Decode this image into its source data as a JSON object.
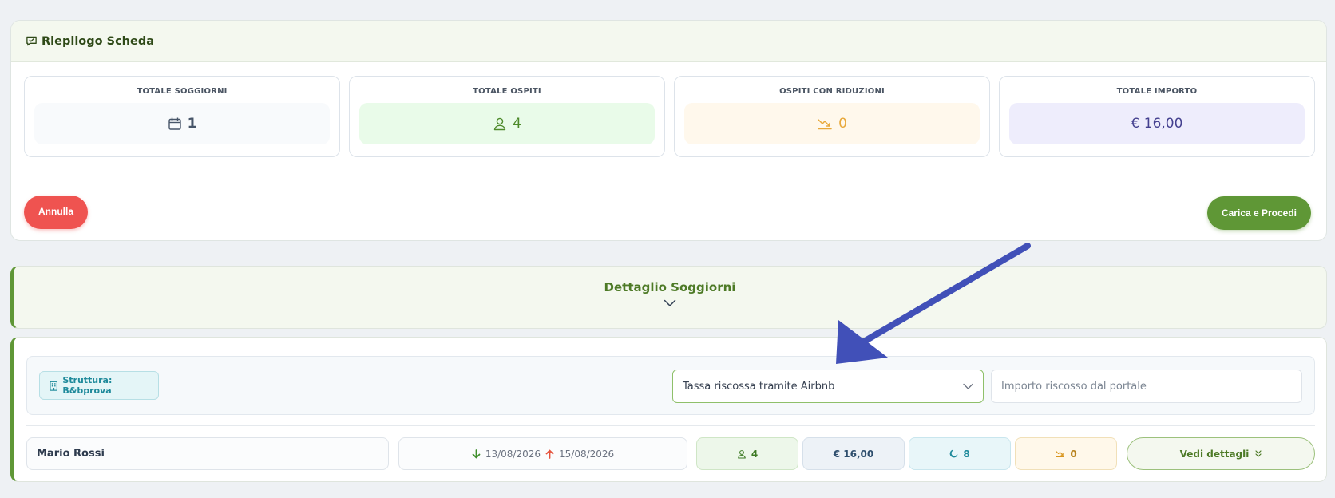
{
  "summary": {
    "title": "Riepilogo Scheda",
    "stats": [
      {
        "label": "TOTALE SOGGIORNI",
        "value": "1",
        "icon": "calendar-icon",
        "color": "#475569"
      },
      {
        "label": "TOTALE OSPITI",
        "value": "4",
        "icon": "user-icon",
        "color": "#4d8a2a"
      },
      {
        "label": "OSPITI CON RIDUZIONI",
        "value": "0",
        "icon": "trend-down-icon",
        "color": "#e8a83a"
      },
      {
        "label": "TOTALE IMPORTO",
        "value": "€ 16,00",
        "icon": "",
        "color": "#44408f"
      }
    ],
    "cancel_label": "Annulla",
    "submit_label": "Carica e Procedi"
  },
  "dettaglio": {
    "title": "Dettaglio Soggiorni"
  },
  "panel": {
    "struttura_label": "Struttura: B&bprova",
    "select_value": "Tassa riscossa tramite Airbnb",
    "importo_placeholder": "Importo riscosso dal portale",
    "row": {
      "guest_name": "Mario Rossi",
      "check_in": "13/08/2026",
      "check_out": "15/08/2026",
      "ospiti": "4",
      "importo": "€ 16,00",
      "notti": "8",
      "riduzioni": "0",
      "details_label": "Vedi dettagli"
    }
  },
  "colors": {
    "accent_green": "#5f9736",
    "danger_red": "#ef5350",
    "annotation_arrow": "#4150b8"
  }
}
